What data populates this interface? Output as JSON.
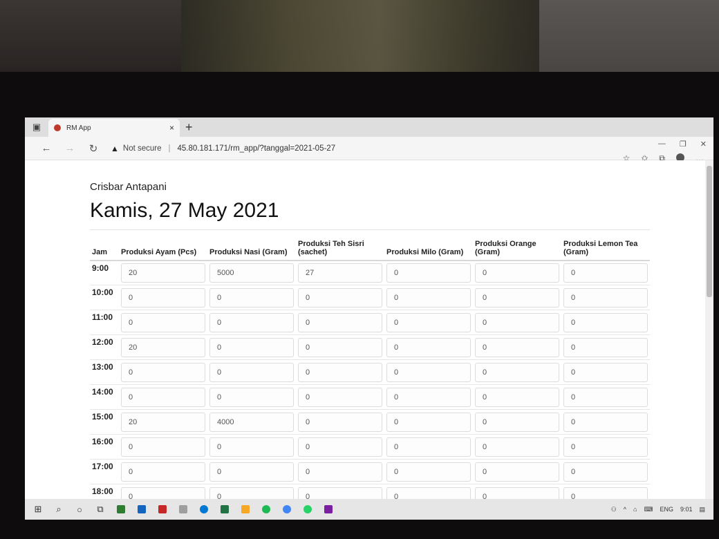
{
  "browser": {
    "tab_title": "RM App",
    "tab_close": "×",
    "new_tab": "+",
    "security_label": "Not secure",
    "separator": "|",
    "url": "45.80.181.171/rm_app/?tanggal=2021-05-27"
  },
  "page": {
    "store_name": "Crisbar Antapani",
    "date_heading": "Kamis, 27 May 2021"
  },
  "table": {
    "headers": [
      "Jam",
      "Produksi Ayam (Pcs)",
      "Produksi Nasi (Gram)",
      "Produksi Teh Sisri (sachet)",
      "Produksi Milo (Gram)",
      "Produksi Orange (Gram)",
      "Produksi Lemon Tea (Gram)"
    ],
    "rows": [
      {
        "jam": "9:00",
        "values": [
          "20",
          "5000",
          "27",
          "0",
          "0",
          "0"
        ]
      },
      {
        "jam": "10:00",
        "values": [
          "0",
          "0",
          "0",
          "0",
          "0",
          "0"
        ]
      },
      {
        "jam": "11:00",
        "values": [
          "0",
          "0",
          "0",
          "0",
          "0",
          "0"
        ]
      },
      {
        "jam": "12:00",
        "values": [
          "20",
          "0",
          "0",
          "0",
          "0",
          "0"
        ]
      },
      {
        "jam": "13:00",
        "values": [
          "0",
          "0",
          "0",
          "0",
          "0",
          "0"
        ]
      },
      {
        "jam": "14:00",
        "values": [
          "0",
          "0",
          "0",
          "0",
          "0",
          "0"
        ]
      },
      {
        "jam": "15:00",
        "values": [
          "20",
          "4000",
          "0",
          "0",
          "0",
          "0"
        ]
      },
      {
        "jam": "16:00",
        "values": [
          "0",
          "0",
          "0",
          "0",
          "0",
          "0"
        ]
      },
      {
        "jam": "17:00",
        "values": [
          "0",
          "0",
          "0",
          "0",
          "0",
          "0"
        ]
      },
      {
        "jam": "18:00",
        "values": [
          "0",
          "0",
          "0",
          "0",
          "0",
          "0"
        ]
      }
    ]
  },
  "taskbar": {
    "language": "ENG",
    "time": "9:01"
  }
}
